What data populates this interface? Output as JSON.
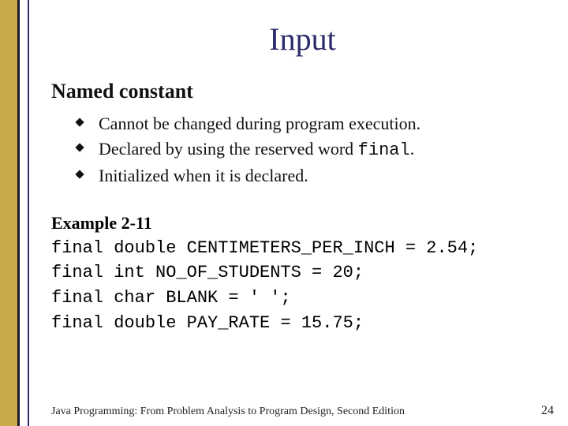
{
  "title": "Input",
  "subtitle": "Named constant",
  "bullets": {
    "b0": "Cannot be changed during program execution.",
    "b1_pre": "Declared by using the reserved word ",
    "b1_code": "final",
    "b1_post": ".",
    "b2": "Initialized when it is declared."
  },
  "example": {
    "label": "Example 2-11",
    "l0": "final double CENTIMETERS_PER_INCH = 2.54;",
    "l1": "final int NO_OF_STUDENTS = 20;",
    "l2": "final char BLANK = ' ';",
    "l3": "final double PAY_RATE = 15.75;"
  },
  "footer": {
    "book": "Java Programming: From Problem Analysis to Program Design, Second Edition",
    "page": "24"
  }
}
